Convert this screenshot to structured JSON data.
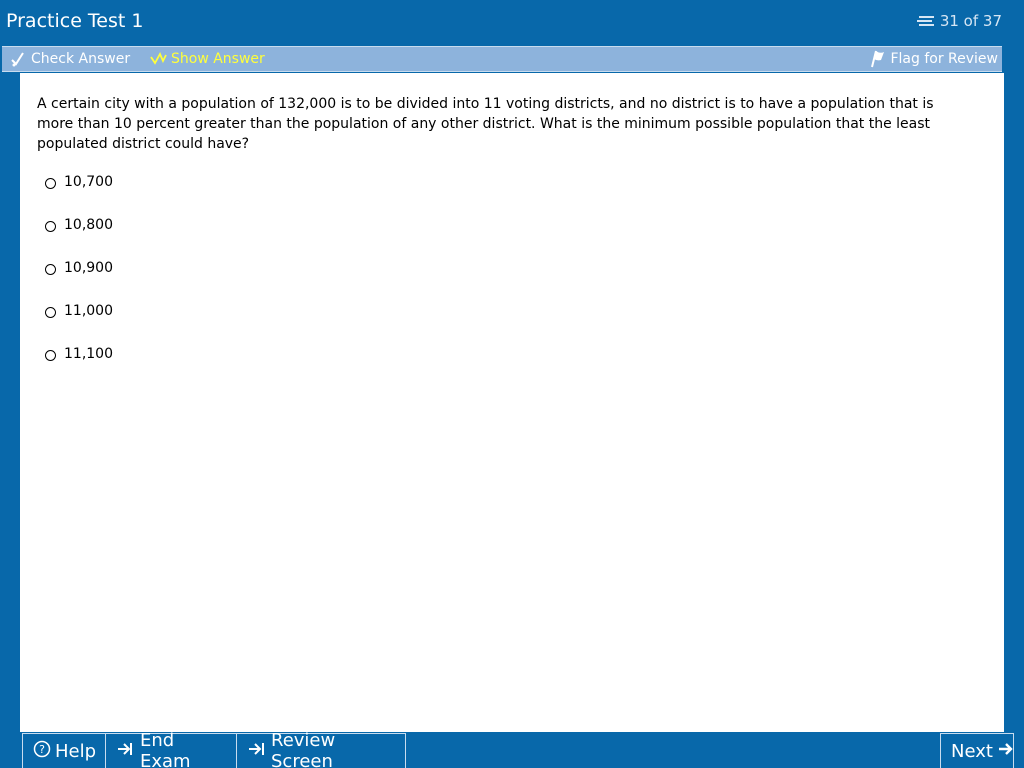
{
  "app": {
    "title": "Practice Test 1",
    "counter": "31 of 37"
  },
  "toolbar": {
    "check_label": "Check Answer",
    "show_label": "Show Answer",
    "flag_label": "Flag for Review"
  },
  "question": {
    "text": "A certain city with a population of 132,000 is to be divided into 11 voting districts, and no district is to have a population that is more than 10 percent greater than the population of any other district.  What is the minimum possible population that the least populated district could have?",
    "options": [
      "10,700",
      "10,800",
      "10,900",
      "11,000",
      "11,100"
    ]
  },
  "bottom": {
    "help_label": "Help",
    "end_label": "End Exam",
    "review_label": "Review Screen",
    "next_label": "Next"
  },
  "colors": {
    "frame_blue": "#0868aa",
    "toolbar_blue": "#8db3dc",
    "highlight_yellow": "#ffff3a"
  },
  "icons": {
    "counter": "pages-stack-icon",
    "check": "check-answer-icon",
    "show": "show-answer-icon",
    "flag": "flag-icon",
    "help": "help-circle-icon",
    "end": "exit-arrow-icon",
    "review": "review-arrow-icon",
    "next": "right-arrow-icon"
  }
}
